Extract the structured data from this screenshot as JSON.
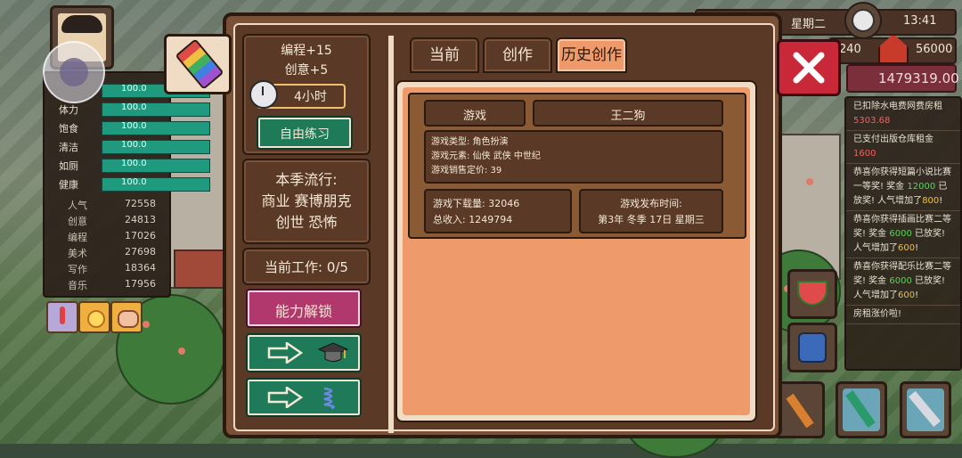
{
  "stats": {
    "bars": [
      {
        "label": "",
        "value": "100.0"
      },
      {
        "label": "体力",
        "value": "100.0"
      },
      {
        "label": "饱食",
        "value": "100.0"
      },
      {
        "label": "清洁",
        "value": "100.0"
      },
      {
        "label": "如厕",
        "value": "100.0"
      },
      {
        "label": "健康",
        "value": "100.0"
      }
    ],
    "numbers": [
      {
        "label": "人气",
        "value": "72558"
      },
      {
        "label": "创意",
        "value": "24813"
      },
      {
        "label": "编程",
        "value": "17026"
      },
      {
        "label": "美术",
        "value": "27698"
      },
      {
        "label": "写作",
        "value": "18364"
      },
      {
        "label": "音乐",
        "value": "17956"
      }
    ]
  },
  "hud": {
    "day_partial": "日",
    "weekday": "星期二",
    "time": "13:41",
    "num_left": "240",
    "num_right": "56000",
    "money": "1479319.00"
  },
  "feed": {
    "items": [
      {
        "text": "已扣除水电费网费房租",
        "amount": "5303.68",
        "amount_color": "red"
      },
      {
        "text": "已支付出版仓库租金",
        "amount": "1600",
        "amount_color": "red"
      },
      {
        "text": "恭喜你获得短篇小说比赛一等奖! 奖金",
        "amount": "12000",
        "amount_color": "grn",
        "extra": "已放奖! 人气增加了",
        "extra_amount": "800",
        "tail": "!"
      },
      {
        "text": "恭喜你获得插画比赛二等奖! 奖金",
        "amount": "6000",
        "amount_color": "grn",
        "extra": "已放奖! 人气增加了",
        "extra_amount": "600",
        "tail": "!"
      },
      {
        "text": "恭喜你获得配乐比赛二等奖! 奖金",
        "amount": "6000",
        "amount_color": "grn",
        "extra": "已放奖! 人气增加了",
        "extra_amount": "600",
        "tail": "!"
      },
      {
        "text": "房租涨价啦!",
        "amount": "",
        "amount_color": "grn"
      }
    ]
  },
  "panel": {
    "gains": {
      "line1": "编程+15",
      "line2": "创意+5"
    },
    "duration": "4小时",
    "practice_button": "自由练习",
    "trend": {
      "title": "本季流行:",
      "line1": "商业 赛博朋克",
      "line2": "创世 恐怖"
    },
    "work": "当前工作: 0/5",
    "unlock_button": "能力解锁",
    "tabs": [
      "当前",
      "创作",
      "历史创作"
    ],
    "record": {
      "category": "游戏",
      "author": "王二狗",
      "type_line": "游戏类型:  角色扮演",
      "elements_line": "游戏元素:  仙侠 武侠 中世纪",
      "price_line": "游戏销售定价: 39",
      "downloads_line": "游戏下载量:  32046",
      "income_line": "总收入:  1249794",
      "release_label": "游戏发布时间:",
      "release_value": "第3年 冬季 17日  星期三"
    }
  }
}
